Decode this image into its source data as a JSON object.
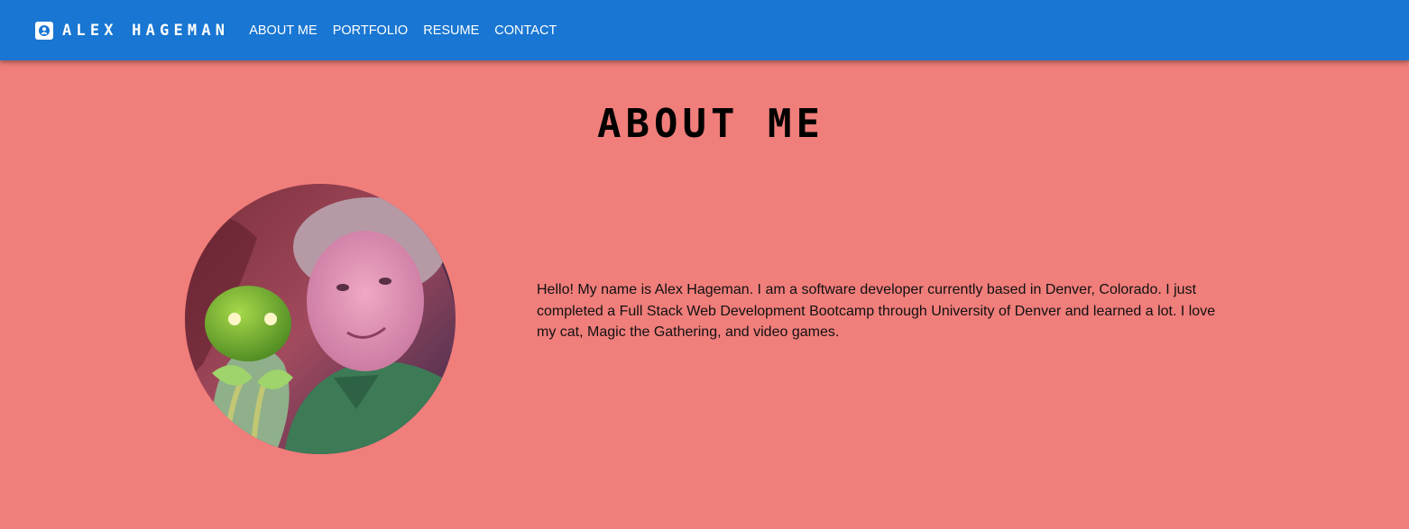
{
  "brand": {
    "name": "ALEX HAGEMAN",
    "icon": "person-badge-icon"
  },
  "nav": {
    "links": [
      "ABOUT ME",
      "PORTFOLIO",
      "RESUME",
      "CONTACT"
    ]
  },
  "colors": {
    "navbar": "#1976d2",
    "page_background": "#f07e7b"
  },
  "about": {
    "title": "ABOUT ME",
    "bio": "Hello! My name is Alex Hageman. I am a software developer currently based in Denver, Colorado. I just completed a Full Stack Web Development Bootcamp through University of Denver and learned a lot. I love my cat, Magic the Gathering, and video games."
  }
}
